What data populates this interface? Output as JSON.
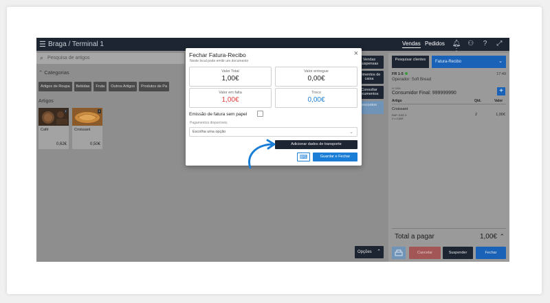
{
  "topbar": {
    "location": "Braga / Terminal 1",
    "nav": [
      "Vendas",
      "Pedidos"
    ]
  },
  "search": {
    "placeholder": "Pesquisa de artigos"
  },
  "categories": {
    "title": "Categorias",
    "items": [
      "Artigos de Roupa",
      "Bebidas",
      "Fruta",
      "Outros Artigos",
      "Produtos de Pa"
    ]
  },
  "articles": {
    "title": "Artigos",
    "items": [
      {
        "name": "Café",
        "price": "0,62€"
      },
      {
        "name": "Croissant",
        "price": "0,50€"
      }
    ]
  },
  "side_buttons": [
    "Vendas suspensas",
    "ovimentos de caixa",
    "Consultar ocumentos",
    "escontos"
  ],
  "options_button": "Opções",
  "right_panel": {
    "search_clients": "Pesquisar clientes",
    "doc_type": "Fatura-Recibo",
    "doc_id": "FR 1-5",
    "time": "17:49",
    "operator": "Operador: Soft Bread",
    "nif": "Nº 0999",
    "client": "Consumidor Final: 999999990",
    "columns": [
      "Artigo",
      "Qtd.",
      "Valor"
    ],
    "lines": [
      {
        "name": "Croissant",
        "ref": "Ref*: EXE.3",
        "unit": "2 x 0,50€",
        "qty": "2",
        "value": "1,00€"
      }
    ],
    "total_label": "Total a pagar",
    "total_value": "1,00€",
    "buttons": {
      "cancel": "Cancelar",
      "suspend": "Suspender",
      "close": "Fechar"
    }
  },
  "modal": {
    "title": "Fechar Fatura-Recibo",
    "subtitle": "Neste local pode emitir um documento",
    "boxes": [
      {
        "label": "Valor Total",
        "value": "1,00€"
      },
      {
        "label": "Valor entregue",
        "value": "0,00€"
      },
      {
        "label": "Valor em falta",
        "value": "1,00€"
      },
      {
        "label": "Troco",
        "value": "0,00€"
      }
    ],
    "paperless_label": "Emissão de fatura sem papel",
    "payments_label": "Pagamentos disponíveis",
    "payments_placeholder": "Escolha uma opção",
    "transport_button": "Adicionar dados de transporte",
    "save_button": "Guardar e Fechar"
  },
  "colors": {
    "accent_blue": "#1a7ed6",
    "dark": "#1d2532",
    "missing_red": "#e03a3a"
  }
}
